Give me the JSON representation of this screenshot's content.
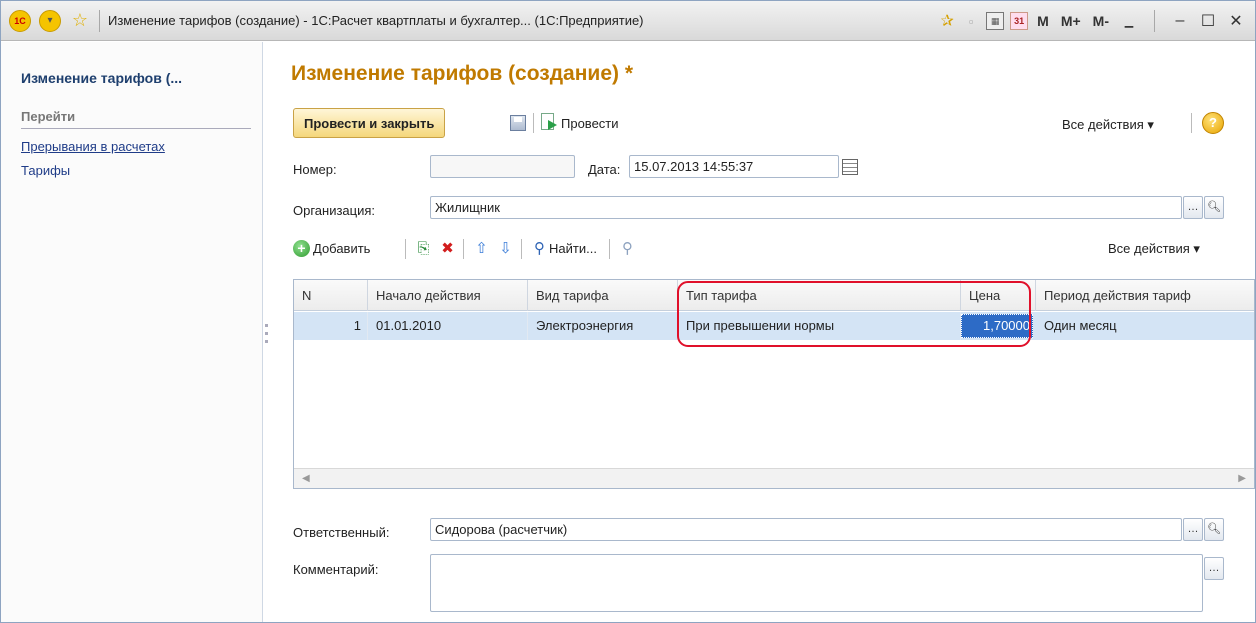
{
  "titlebar": {
    "title": "Изменение тарифов (создание) - 1С:Расчет квартплаты и бухгалтер... (1С:Предприятие)",
    "logo": "1С",
    "m_buttons": [
      "M",
      "M+",
      "M-"
    ]
  },
  "sidebar": {
    "title": "Изменение тарифов (...",
    "nav_title": "Перейти",
    "links": [
      "Прерывания в расчетах",
      "Тарифы"
    ]
  },
  "main": {
    "title": "Изменение тарифов (создание) *",
    "toolbar": {
      "post_close": "Провести и закрыть",
      "post": "Провести",
      "all_actions": "Все действия ▾",
      "help": "?"
    },
    "fields": {
      "number_label": "Номер:",
      "number_value": "",
      "date_label": "Дата:",
      "date_value": "15.07.2013 14:55:37",
      "org_label": "Организация:",
      "org_value": "Жилищник",
      "responsible_label": "Ответственный:",
      "responsible_value": "Сидорова (расчетчик)",
      "comment_label": "Комментарий:",
      "comment_value": ""
    },
    "table_toolbar": {
      "add": "Добавить",
      "find": "Найти...",
      "all_actions": "Все действия ▾"
    },
    "table": {
      "columns": [
        "N",
        "Начало действия",
        "Вид тарифа",
        "Тип тарифа",
        "Цена",
        "Период действия тариф"
      ],
      "rows": [
        [
          "1",
          "01.01.2010",
          "Электроэнергия",
          "При превышении нормы",
          "1,70000",
          "Один месяц"
        ]
      ]
    }
  },
  "colors": {
    "title_accent": "#c07a00",
    "link": "#1f3c88",
    "selection": "#2d6bc6",
    "highlight_outline": "#e0102a"
  }
}
